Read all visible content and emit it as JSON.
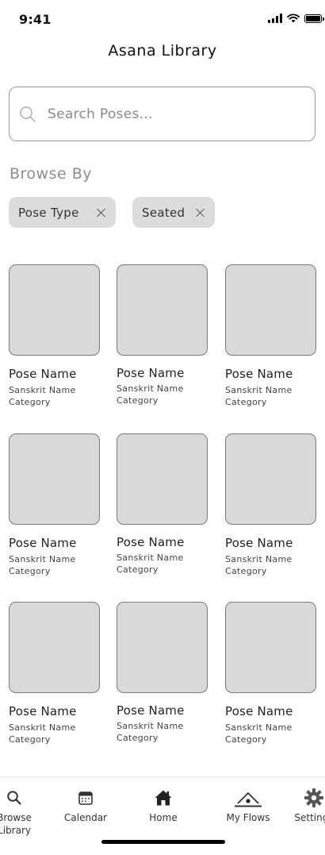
{
  "status_bar": {
    "time": "9:41"
  },
  "header": {
    "title": "Asana Library"
  },
  "search": {
    "placeholder": "Search Poses..."
  },
  "browse": {
    "heading": "Browse By",
    "filters": [
      {
        "label": "Pose Type"
      },
      {
        "label": "Seated"
      }
    ]
  },
  "poses": [
    {
      "name": "Pose Name",
      "sanskrit": "Sanskrit Name",
      "category": "Category"
    },
    {
      "name": "Pose Name",
      "sanskrit": "Sanskrit Name",
      "category": "Category"
    },
    {
      "name": "Pose Name",
      "sanskrit": "Sanskrit Name",
      "category": "Category"
    },
    {
      "name": "Pose Name",
      "sanskrit": "Sanskrit Name",
      "category": "Category"
    },
    {
      "name": "Pose Name",
      "sanskrit": "Sanskrit Name",
      "category": "Category"
    },
    {
      "name": "Pose Name",
      "sanskrit": "Sanskrit Name",
      "category": "Category"
    },
    {
      "name": "Pose Name",
      "sanskrit": "Sanskrit Name",
      "category": "Category"
    },
    {
      "name": "Pose Name",
      "sanskrit": "Sanskrit Name",
      "category": "Category"
    },
    {
      "name": "Pose Name",
      "sanskrit": "Sanskrit Name",
      "category": "Category"
    }
  ],
  "bottom_nav": {
    "items": [
      {
        "label": "Browse\nLibrary",
        "icon": "search-icon"
      },
      {
        "label": "Calendar",
        "icon": "calendar-icon"
      },
      {
        "label": "Home",
        "icon": "home-icon"
      },
      {
        "label": "My Flows",
        "icon": "flows-icon"
      },
      {
        "label": "Settings",
        "icon": "gear-icon"
      }
    ]
  }
}
